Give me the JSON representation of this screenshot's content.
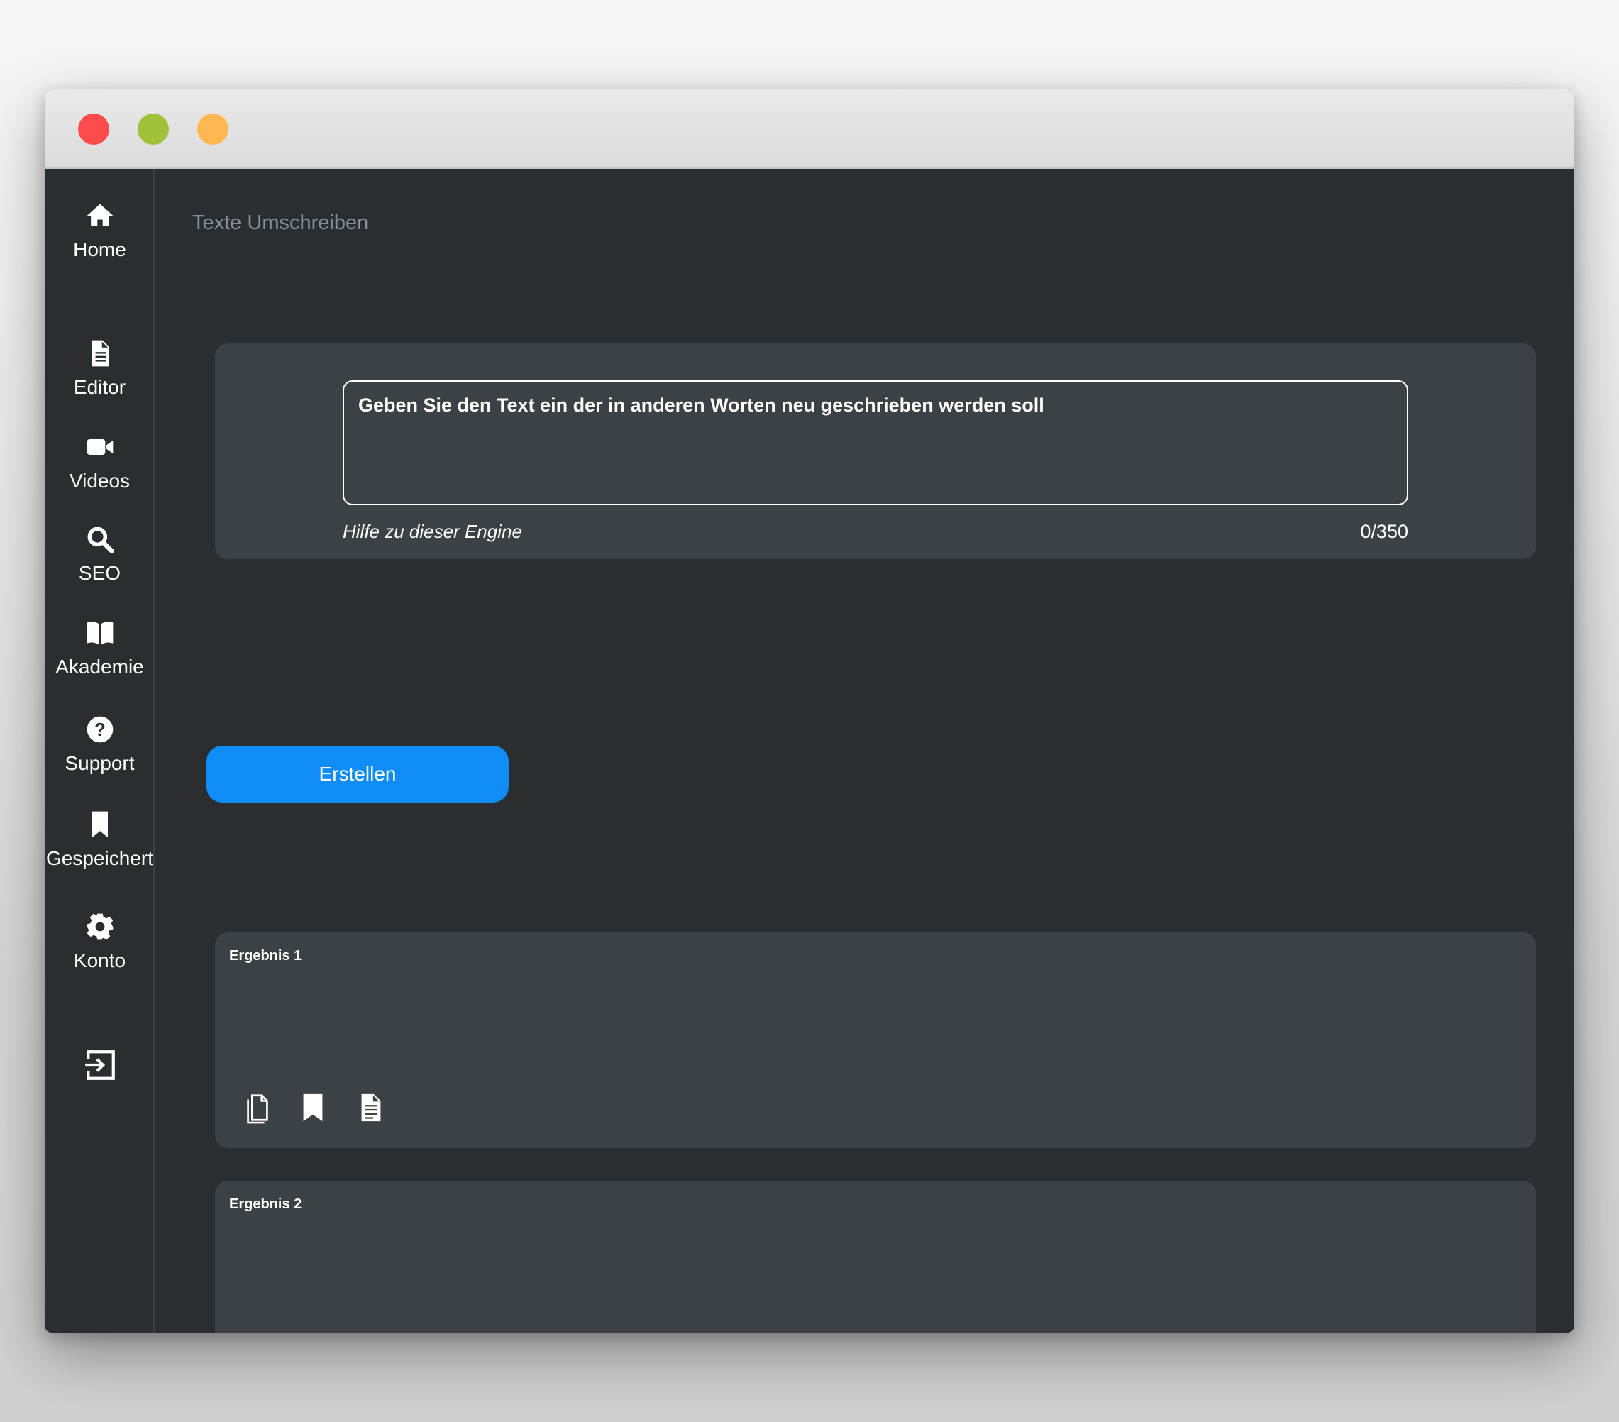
{
  "window": {
    "controls": [
      {
        "name": "close",
        "color": "#fe4c4c"
      },
      {
        "name": "minimize",
        "color": "#9fc23a"
      },
      {
        "name": "zoom",
        "color": "#ffb751"
      }
    ]
  },
  "sidebar": {
    "items": [
      {
        "id": "home",
        "label": "Home",
        "icon": "home-icon"
      },
      {
        "id": "editor",
        "label": "Editor",
        "icon": "document-icon"
      },
      {
        "id": "videos",
        "label": "Videos",
        "icon": "video-camera-icon"
      },
      {
        "id": "seo",
        "label": "SEO",
        "icon": "search-icon"
      },
      {
        "id": "akademie",
        "label": "Akademie",
        "icon": "book-icon"
      },
      {
        "id": "support",
        "label": "Support",
        "icon": "question-circle-icon"
      },
      {
        "id": "gespeichert",
        "label": "Gespeichert",
        "icon": "bookmark-icon"
      },
      {
        "id": "konto",
        "label": "Konto",
        "icon": "gear-icon"
      }
    ],
    "logout_icon": "logout-icon"
  },
  "main": {
    "title": "Texte Umschreiben",
    "input": {
      "placeholder": "Geben Sie den Text ein der in anderen Worten neu geschrieben werden soll",
      "value": "",
      "help_link": "Hilfe zu dieser Engine",
      "counter": "0/350"
    },
    "create_button": "Erstellen",
    "results": [
      {
        "title": "Ergebnis 1",
        "actions": [
          "copy-icon",
          "bookmark-icon",
          "document-icon"
        ]
      },
      {
        "title": "Ergebnis 2",
        "actions": [
          "copy-icon",
          "bookmark-icon",
          "document-icon"
        ]
      }
    ]
  },
  "colors": {
    "accent": "#0f8cf5",
    "background": "#2a2e31",
    "card": "#3c4145",
    "muted_text": "#8a8f93"
  }
}
